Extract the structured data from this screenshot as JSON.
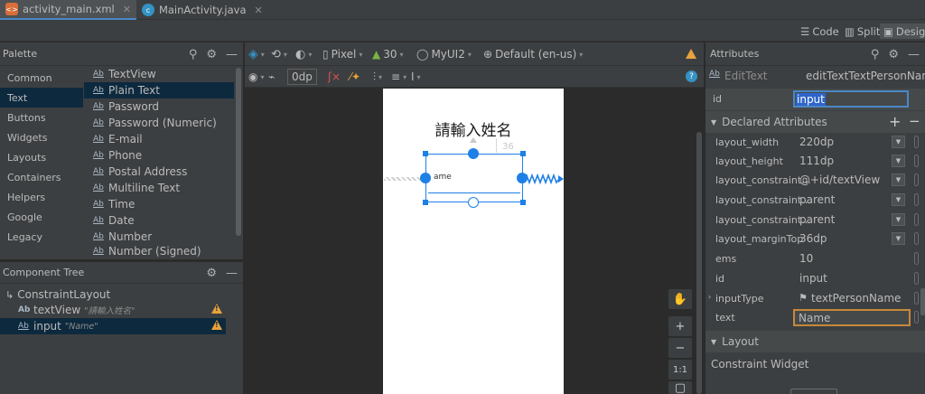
{
  "tabs": [
    {
      "label": "activity_main.xml",
      "icon": "xml-file-icon"
    },
    {
      "label": "MainActivity.java",
      "icon": "java-class-icon"
    }
  ],
  "view_modes": {
    "code": "Code",
    "split": "Split",
    "design": "Design"
  },
  "palette": {
    "title": "Palette",
    "categories": [
      "Common",
      "Text",
      "Buttons",
      "Widgets",
      "Layouts",
      "Containers",
      "Helpers",
      "Google",
      "Legacy"
    ],
    "selected_category": "Text",
    "items": [
      "TextView",
      "Plain Text",
      "Password",
      "Password (Numeric)",
      "E-mail",
      "Phone",
      "Postal Address",
      "Multiline Text",
      "Time",
      "Date",
      "Number",
      "Number (Signed)"
    ],
    "selected_item": "Plain Text"
  },
  "component_tree": {
    "title": "Component Tree",
    "root": "ConstraintLayout",
    "children": [
      {
        "name": "textView",
        "hint": "\"請輸入姓名\""
      },
      {
        "name": "input",
        "hint": "\"Name\""
      }
    ]
  },
  "design_toolbar": {
    "device": "Pixel",
    "api": "30",
    "theme": "MyUI2",
    "locale": "Default (en-us)",
    "margin": "0dp"
  },
  "canvas": {
    "title_text": "請輸入姓名",
    "field_text": "ame",
    "margin_label": "36",
    "rail": {
      "zoom_in": "+",
      "zoom_out": "−",
      "one_to_one": "1:1"
    }
  },
  "attributes": {
    "title": "Attributes",
    "widget_type": "EditText",
    "widget_id_name": "editTextTextPersonName",
    "id_label": "id",
    "id_value": "input",
    "declared_title": "Declared Attributes",
    "declared": [
      {
        "key": "layout_width",
        "value": "220dp",
        "dropdown": true
      },
      {
        "key": "layout_height",
        "value": "111dp",
        "dropdown": true
      },
      {
        "key": "layout_constraint...",
        "value": "@+id/textView",
        "dropdown": true
      },
      {
        "key": "layout_constraint...",
        "value": "parent",
        "dropdown": true
      },
      {
        "key": "layout_constraint...",
        "value": "parent",
        "dropdown": true
      },
      {
        "key": "layout_marginTop",
        "value": "36dp",
        "dropdown": true
      },
      {
        "key": "ems",
        "value": "10",
        "dropdown": false
      },
      {
        "key": "id",
        "value": "input",
        "dropdown": false
      },
      {
        "key": "inputType",
        "value": "textPersonName",
        "dropdown": false
      },
      {
        "key": "text",
        "value": "Name",
        "dropdown": false
      }
    ],
    "layout_title": "Layout",
    "constraint_widget": "Constraint Widget"
  },
  "colors": {
    "accent": "#4a88c7",
    "selection": "#0d293e",
    "warning": "#e8a33e",
    "blueprint": "#1e7fe6"
  }
}
